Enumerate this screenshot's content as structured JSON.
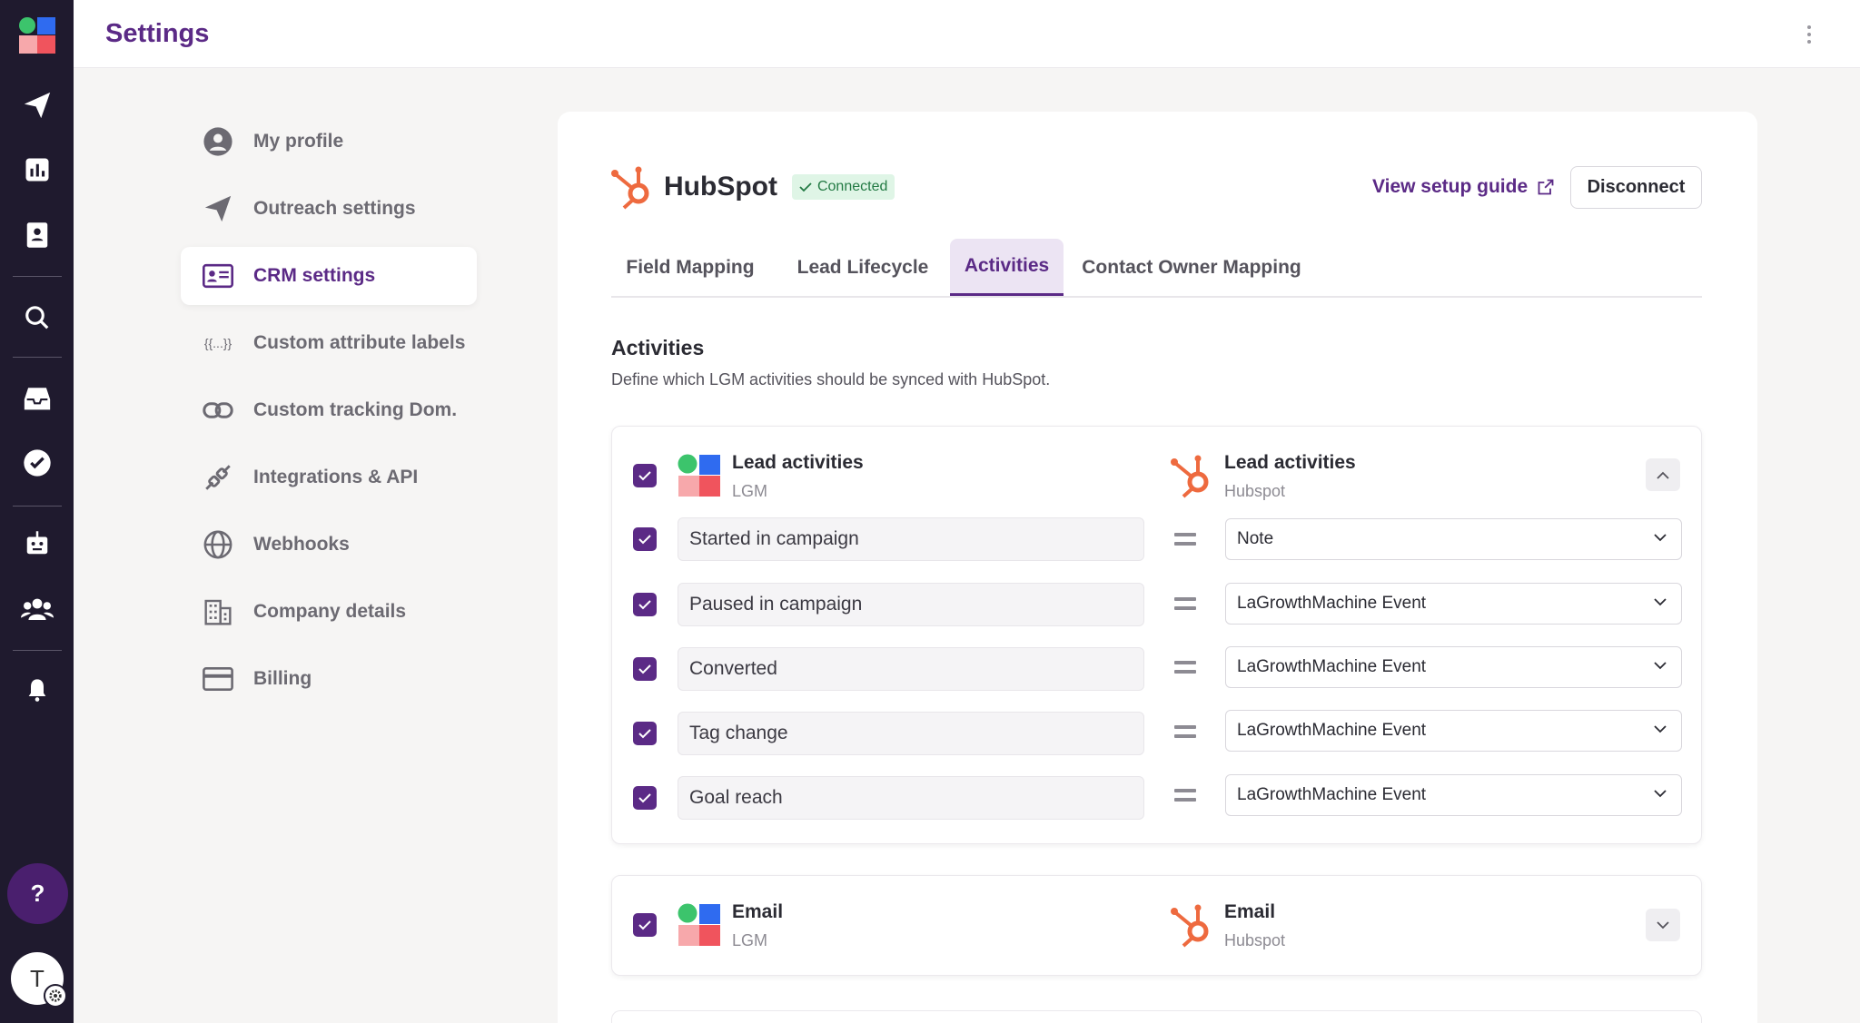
{
  "header": {
    "title": "Settings"
  },
  "nav": {
    "items": [
      {
        "label": "My profile",
        "icon": "user-circle-icon"
      },
      {
        "label": "Outreach settings",
        "icon": "paper-plane-icon"
      },
      {
        "label": "CRM settings",
        "icon": "contact-card-icon",
        "active": true
      },
      {
        "label": "Custom attribute labels",
        "icon": "curly-braces-icon"
      },
      {
        "label": "Custom tracking Dom.",
        "icon": "link-icon"
      },
      {
        "label": "Integrations & API",
        "icon": "plug-icon"
      },
      {
        "label": "Webhooks",
        "icon": "globe-icon"
      },
      {
        "label": "Company details",
        "icon": "building-icon"
      },
      {
        "label": "Billing",
        "icon": "credit-card-icon"
      }
    ]
  },
  "integration": {
    "name": "HubSpot",
    "status": "Connected",
    "setup_guide": "View setup guide",
    "disconnect": "Disconnect"
  },
  "tabs": [
    {
      "label": "Field Mapping"
    },
    {
      "label": "Lead Lifecycle"
    },
    {
      "label": "Activities",
      "active": true
    },
    {
      "label": "Contact Owner Mapping"
    }
  ],
  "section": {
    "title": "Activities",
    "description": "Define which LGM activities should be synced with HubSpot."
  },
  "groups": [
    {
      "left_title": "Lead activities",
      "left_sub": "LGM",
      "right_title": "Lead activities",
      "right_sub": "Hubspot",
      "expanded": true,
      "rows": [
        {
          "activity": "Started in campaign",
          "mapping": "Note"
        },
        {
          "activity": "Paused in campaign",
          "mapping": "LaGrowthMachine Event"
        },
        {
          "activity": "Converted",
          "mapping": "LaGrowthMachine Event"
        },
        {
          "activity": "Tag change",
          "mapping": "LaGrowthMachine Event"
        },
        {
          "activity": "Goal reach",
          "mapping": "LaGrowthMachine Event"
        }
      ]
    },
    {
      "left_title": "Email",
      "left_sub": "LGM",
      "right_title": "Email",
      "right_sub": "Hubspot",
      "expanded": false
    }
  ],
  "rail": {
    "help": "?",
    "avatar": "T"
  },
  "colors": {
    "accent": "#5b2a86",
    "hubspot": "#ee6a3f",
    "rail": "#1f1a2e",
    "connected_bg": "#dff5e6"
  }
}
